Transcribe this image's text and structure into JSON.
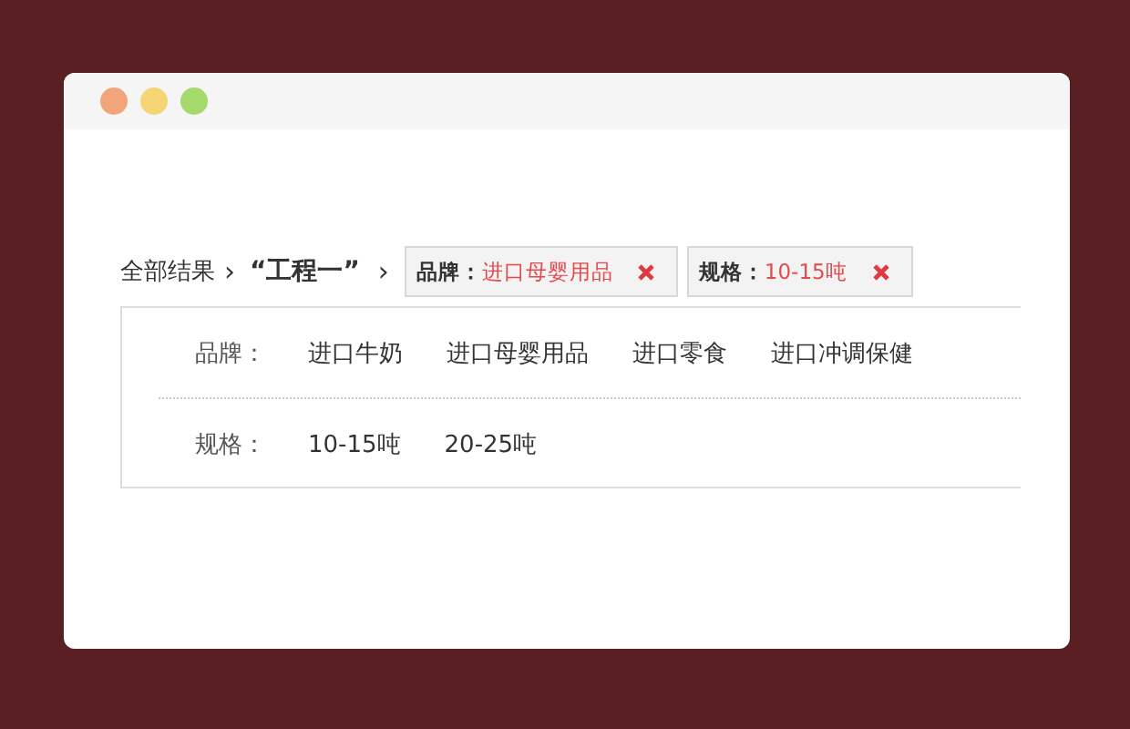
{
  "breadcrumb": {
    "root": "全部结果",
    "separator_1": "›",
    "keyword": "“工程一”",
    "separator_2": "›"
  },
  "active_filters": [
    {
      "label": "品牌：",
      "value": "进口母婴用品"
    },
    {
      "label": "规格：",
      "value": "10-15吨"
    }
  ],
  "filter_rows": [
    {
      "label": "品牌：",
      "options": [
        "进口牛奶",
        "进口母婴用品",
        "进口零食",
        "进口冲调保健"
      ]
    },
    {
      "label": "规格：",
      "options": [
        "10-15吨",
        "20-25吨"
      ]
    }
  ]
}
